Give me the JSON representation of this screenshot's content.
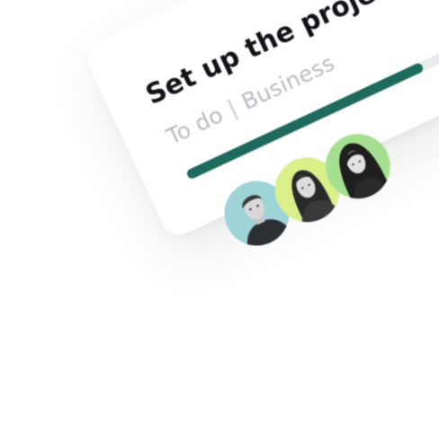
{
  "card": {
    "title": "Set up the project",
    "status": "To do",
    "separator": "|",
    "category": "Business",
    "progress_percent": 67,
    "colors": {
      "progress_fill": "#1e6b5d",
      "progress_track": "#e9ebee"
    },
    "assignees": [
      {
        "icon": "person-photo",
        "bg": "#9ed3d8"
      },
      {
        "icon": "person-photo",
        "bg": "#d8ef8a"
      },
      {
        "icon": "person-photo",
        "bg": "#a5e090"
      }
    ]
  }
}
